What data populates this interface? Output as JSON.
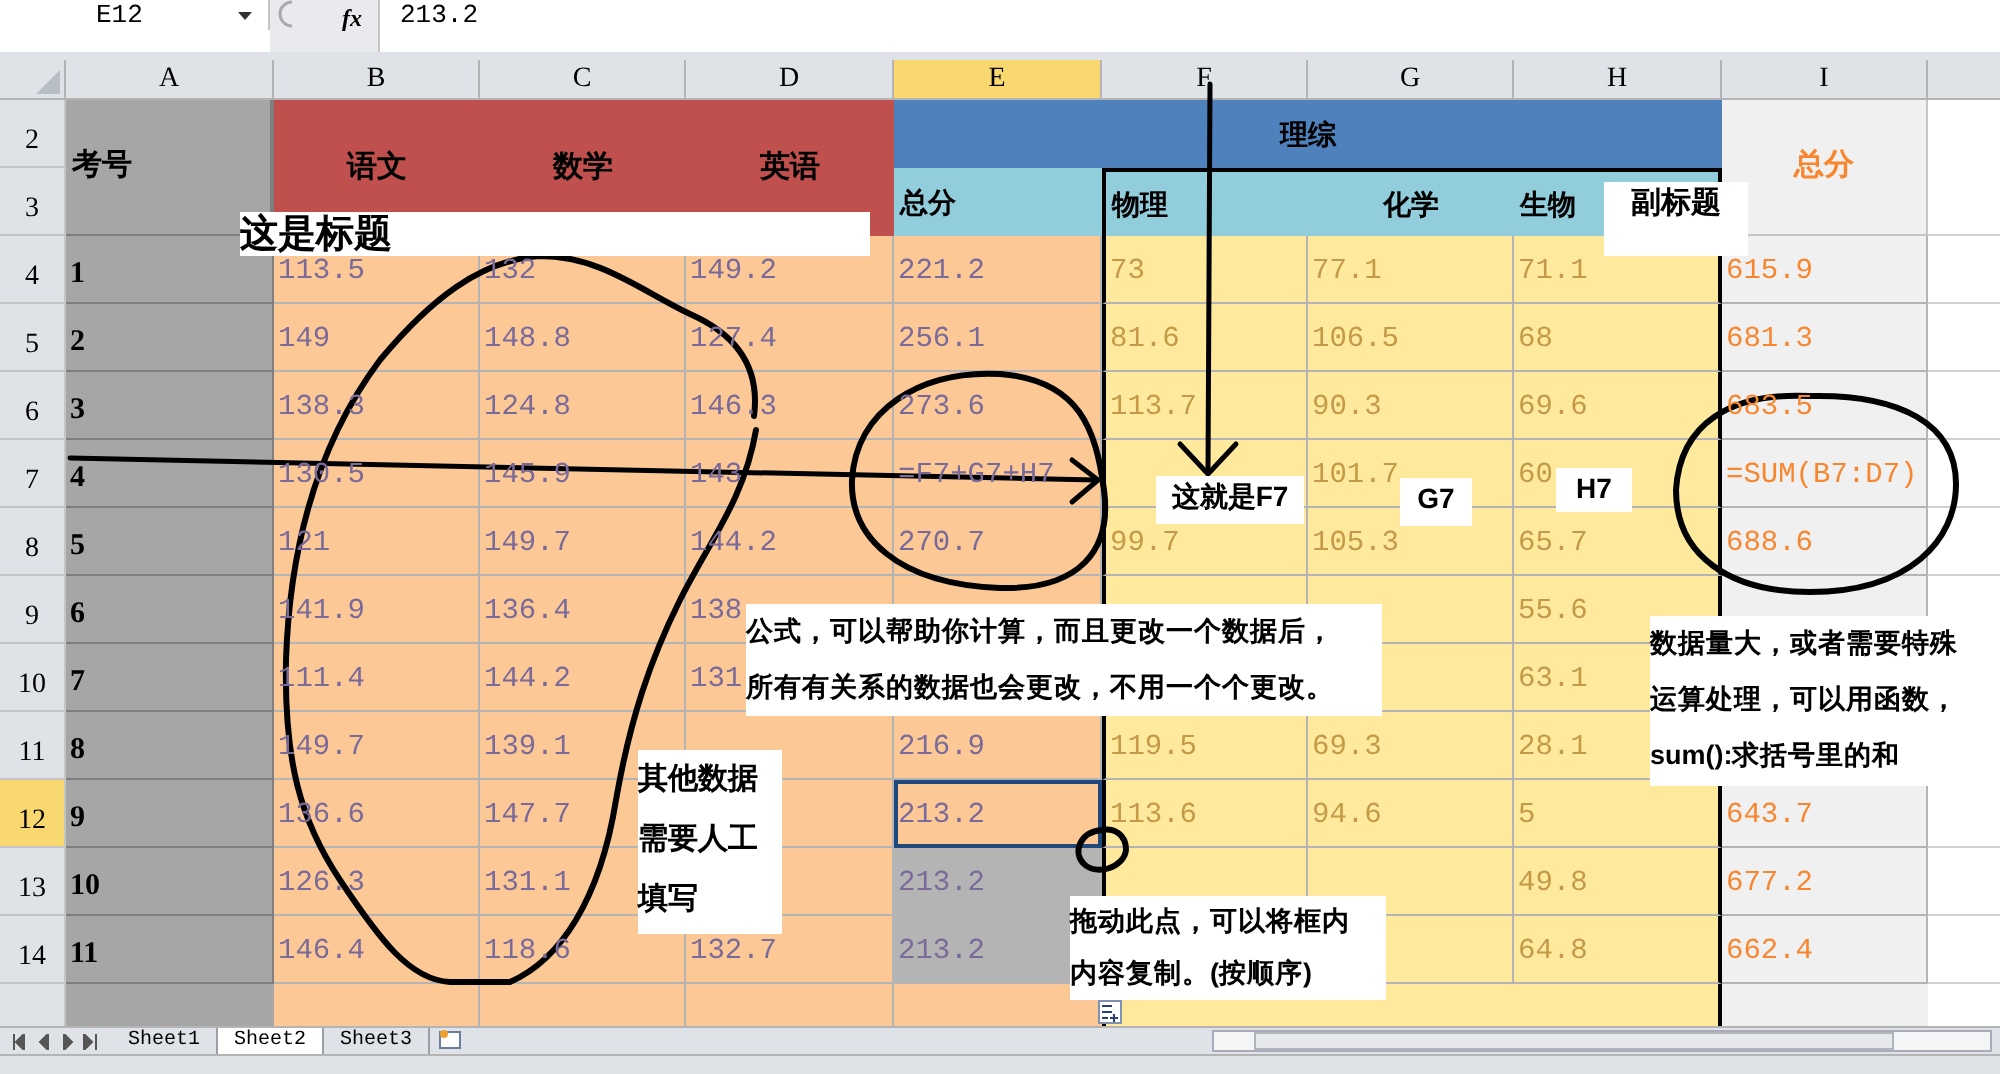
{
  "formula_bar": {
    "name_box": "E12",
    "function_label": "fx",
    "value": "213.2"
  },
  "columns": [
    {
      "label": "A",
      "selected": false
    },
    {
      "label": "B",
      "selected": false
    },
    {
      "label": "C",
      "selected": false
    },
    {
      "label": "D",
      "selected": false
    },
    {
      "label": "E",
      "selected": true
    },
    {
      "label": "F",
      "selected": false
    },
    {
      "label": "G",
      "selected": false
    },
    {
      "label": "H",
      "selected": false
    },
    {
      "label": "I",
      "selected": false
    }
  ],
  "header_rows": [
    "2",
    "3"
  ],
  "header": {
    "id_label": "考号",
    "subjects": [
      "语文",
      "数学",
      "英语"
    ],
    "group": "理综",
    "group_total": "总分",
    "group_subjects": [
      "物理",
      "化学",
      "生物"
    ],
    "total": "总分"
  },
  "rows": [
    {
      "number": "4",
      "selected": false,
      "copied": false,
      "cells": [
        "1",
        "113.5",
        "132",
        "149.2",
        "221.2",
        "73",
        "77.1",
        "71.1",
        "615.9"
      ]
    },
    {
      "number": "5",
      "selected": false,
      "copied": false,
      "cells": [
        "2",
        "149",
        "148.8",
        "127.4",
        "256.1",
        "81.6",
        "106.5",
        "68",
        "681.3"
      ]
    },
    {
      "number": "6",
      "selected": false,
      "copied": false,
      "cells": [
        "3",
        "138.3",
        "124.8",
        "146.3",
        "273.6",
        "113.7",
        "90.3",
        "69.6",
        "683.5"
      ]
    },
    {
      "number": "7",
      "selected": false,
      "copied": false,
      "cells": [
        "4",
        "130.5",
        "145.9",
        "143",
        "=F7+G7+H7",
        null,
        "101.7",
        "60",
        "=SUM(B7:D7)"
      ]
    },
    {
      "number": "8",
      "selected": false,
      "copied": false,
      "cells": [
        "5",
        "121",
        "149.7",
        "144.2",
        "270.7",
        "99.7",
        "105.3",
        "65.7",
        "688.6"
      ]
    },
    {
      "number": "9",
      "selected": false,
      "cells": [
        "6",
        "141.9",
        "136.4",
        "138",
        null,
        null,
        null,
        "55.6",
        null
      ]
    },
    {
      "number": "10",
      "selected": false,
      "cells": [
        "7",
        "111.4",
        "144.2",
        "131",
        null,
        null,
        null,
        "63.1",
        null
      ]
    },
    {
      "number": "11",
      "selected": false,
      "copied": false,
      "cells": [
        "8",
        "149.7",
        "139.1",
        null,
        "216.9",
        "119.5",
        "69.3",
        "28.1",
        null
      ]
    },
    {
      "number": "12",
      "selected": true,
      "copied": false,
      "cells": [
        "9",
        "136.6",
        "147.7",
        null,
        "213.2",
        "113.6",
        "94.6",
        "5",
        "643.7"
      ]
    },
    {
      "number": "13",
      "selected": false,
      "copied": true,
      "cells": [
        "10",
        "126.3",
        "131.1",
        null,
        "213.2",
        null,
        null,
        "49.8",
        "677.2"
      ]
    },
    {
      "number": "14",
      "selected": false,
      "copied": true,
      "cells": [
        "11",
        "146.4",
        "118.6",
        "132.7",
        "213.2",
        null,
        null,
        "64.8",
        "662.4"
      ]
    }
  ],
  "sheet_tabs": [
    {
      "label": "Sheet1",
      "selected": false
    },
    {
      "label": "Sheet2",
      "selected": true
    },
    {
      "label": "Sheet3",
      "selected": false
    }
  ],
  "annotations": [
    {
      "lines": [
        "这是标题"
      ]
    },
    {
      "lines": [
        "副标题"
      ]
    },
    {
      "lines": [
        "这就是F7"
      ]
    },
    {
      "lines": [
        "G7"
      ]
    },
    {
      "lines": [
        "H7"
      ]
    },
    {
      "lines": [
        "公式，可以帮助你计算，而且更改一个数据后，",
        "所有有关系的数据也会更改，不用一个个更改。"
      ]
    },
    {
      "lines": [
        "其他数据",
        "需要人工",
        "填写"
      ]
    },
    {
      "lines": [
        "数据量大，或者需要特殊",
        "运算处理，可以用函数，",
        "sum():求括号里的和"
      ]
    },
    {
      "lines": [
        "拖动此点，可以将框内",
        "内容复制。(按顺序)"
      ]
    }
  ]
}
